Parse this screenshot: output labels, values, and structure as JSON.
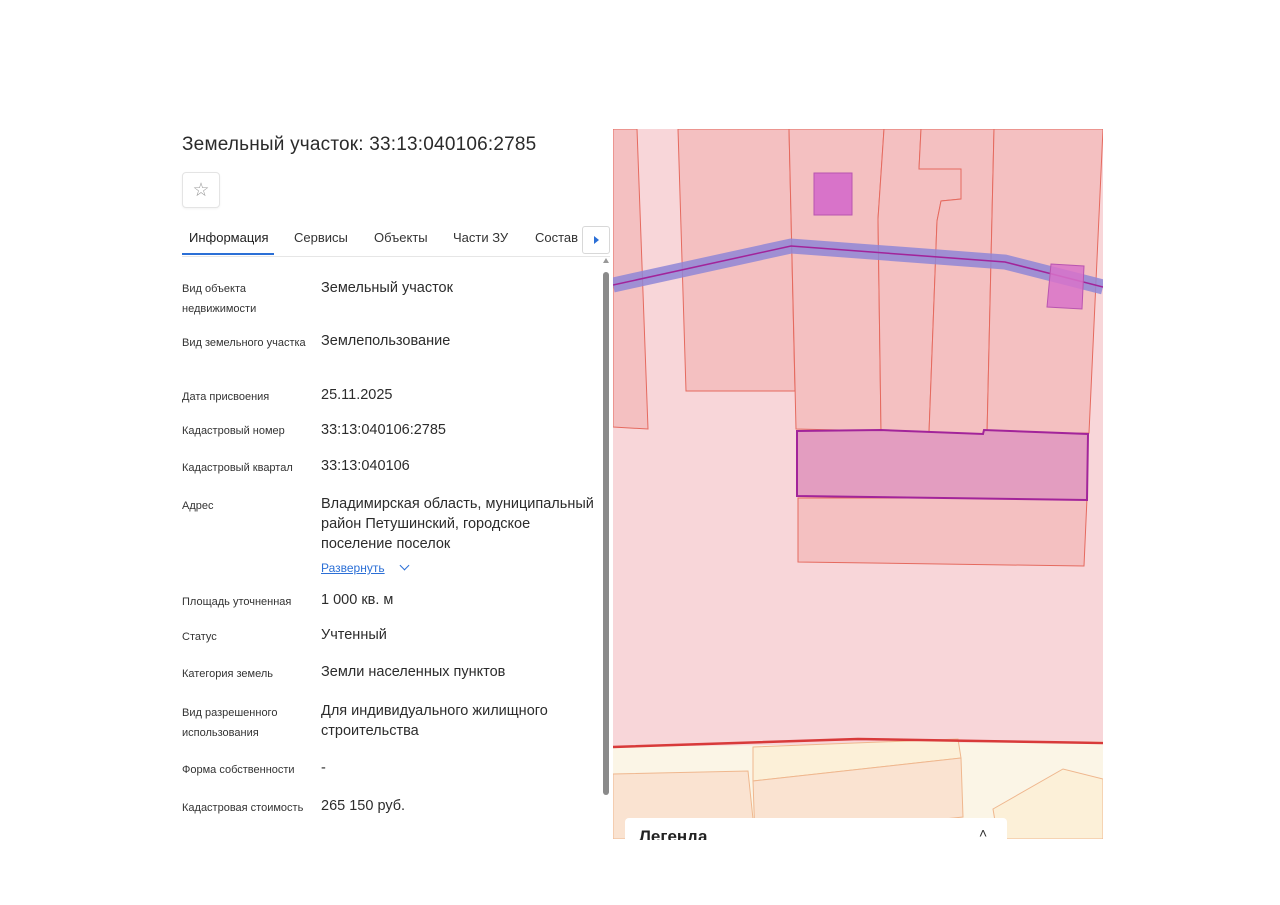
{
  "header": {
    "title": "Земельный участок: 33:13:040106:2785"
  },
  "favorite": {
    "icon": "star-outline-icon",
    "glyph": "☆"
  },
  "tabs": [
    {
      "label": "Информация",
      "active": true
    },
    {
      "label": "Сервисы",
      "active": false
    },
    {
      "label": "Объекты",
      "active": false
    },
    {
      "label": "Части ЗУ",
      "active": false
    },
    {
      "label": "Состав",
      "active": false
    }
  ],
  "info": {
    "object_type": {
      "label": "Вид объекта недвижимости",
      "value": "Земельный участок"
    },
    "land_type": {
      "label": "Вид земельного участка",
      "value": "Землепользование"
    },
    "assigned_date": {
      "label": "Дата присвоения",
      "value": "25.11.2025"
    },
    "cadastral_number": {
      "label": "Кадастровый номер",
      "value": "33:13:040106:2785"
    },
    "cadastral_quarter": {
      "label": "Кадастровый квартал",
      "value": "33:13:040106"
    },
    "address": {
      "label": "Адрес",
      "value": "Владимирская область, муниципальный район Петушинский, городское поселение поселок",
      "expand_label": "Развернуть"
    },
    "area": {
      "label": "Площадь уточненная",
      "value": "1 000 кв. м"
    },
    "status": {
      "label": "Статус",
      "value": "Учтенный"
    },
    "category": {
      "label": "Категория земель",
      "value": "Земли населенных пунктов"
    },
    "permitted_use": {
      "label": "Вид разрешенного использования",
      "value": "Для индивидуального жилищного строительства"
    },
    "ownership": {
      "label": "Форма собственности",
      "value": "-"
    },
    "cadastral_value": {
      "label": "Кадастровая стоимость",
      "value": "265 150 руб."
    }
  },
  "legend": {
    "title": "Легенда",
    "toggle_glyph": "˄"
  },
  "colors": {
    "accent": "#2b6fd6",
    "parcel_fill": "#f4c0c1",
    "selected_parcel": "#e39dc0",
    "selected_border": "#a2249a",
    "road_band": "#9a8fd8",
    "boundary_red": "#d83a3a",
    "building": "#d873c9"
  }
}
